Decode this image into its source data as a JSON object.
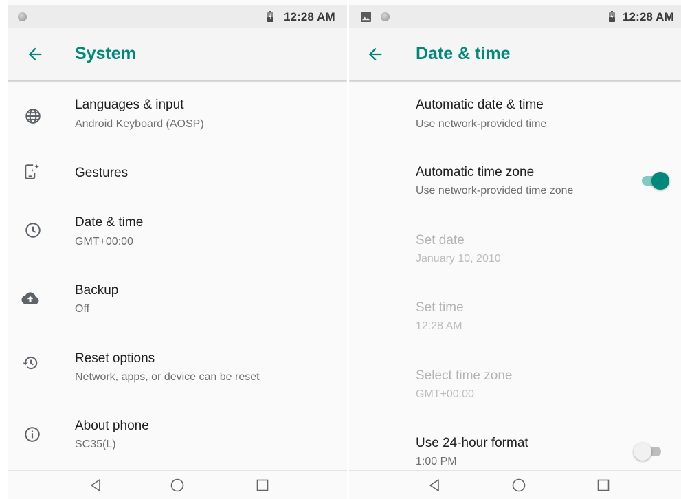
{
  "left_screen": {
    "status": {
      "time": "12:28 AM",
      "icons": [
        "notification-dot-icon",
        "battery-charging-icon"
      ]
    },
    "appbar": {
      "back_icon": "arrow-left-icon",
      "title": "System"
    },
    "items": [
      {
        "icon": "globe-icon",
        "title": "Languages & input",
        "summary": "Android Keyboard (AOSP)"
      },
      {
        "icon": "gestures-phone-icon",
        "title": "Gestures",
        "summary": ""
      },
      {
        "icon": "clock-icon",
        "title": "Date & time",
        "summary": "GMT+00:00"
      },
      {
        "icon": "cloud-upload-icon",
        "title": "Backup",
        "summary": "Off"
      },
      {
        "icon": "restore-history-icon",
        "title": "Reset options",
        "summary": "Network, apps, or device can be reset"
      },
      {
        "icon": "info-icon",
        "title": "About phone",
        "summary": "SC35(L)"
      }
    ],
    "navbar": [
      "back-triangle-icon",
      "home-circle-icon",
      "recents-square-icon"
    ]
  },
  "right_screen": {
    "status": {
      "time": "12:28 AM",
      "icons": [
        "image-icon",
        "notification-dot-icon",
        "battery-charging-icon"
      ]
    },
    "appbar": {
      "back_icon": "arrow-left-icon",
      "title": "Date & time"
    },
    "items": [
      {
        "title": "Automatic date & time",
        "summary": "Use network-provided time",
        "enabled": true
      },
      {
        "title": "Automatic time zone",
        "summary": "Use network-provided time zone",
        "enabled": true,
        "switch": "on"
      },
      {
        "title": "Set date",
        "summary": "January 10, 2010",
        "enabled": false
      },
      {
        "title": "Set time",
        "summary": "12:28 AM",
        "enabled": false
      },
      {
        "title": "Select time zone",
        "summary": "GMT+00:00",
        "enabled": false
      },
      {
        "title": "Use 24-hour format",
        "summary": "1:00 PM",
        "enabled": true,
        "switch": "off"
      }
    ],
    "navbar": [
      "back-triangle-icon",
      "home-circle-icon",
      "recents-square-icon"
    ]
  },
  "colors": {
    "accent": "#00897b",
    "switch_on_track": "#80cbc4",
    "switch_off_track": "#bdbdbd",
    "switch_off_thumb": "#f1f1f1",
    "icon": "#5f6368"
  }
}
